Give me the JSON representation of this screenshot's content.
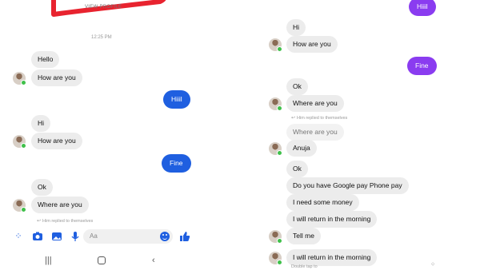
{
  "left": {
    "view_profile": "VIEW PROFILE",
    "timestamp": "12:25 PM",
    "messages": [
      {
        "text": "Hello"
      },
      {
        "text": "How are you"
      },
      {
        "text": "Hiiil"
      },
      {
        "text": "Hi"
      },
      {
        "text": "How are you"
      },
      {
        "text": "Fine"
      },
      {
        "text": "Ok"
      },
      {
        "text": "Where are you"
      }
    ],
    "reply_note": "Him replied to themselves",
    "composer_placeholder": "Aa"
  },
  "right": {
    "messages": [
      {
        "text": "Hiiil"
      },
      {
        "text": "Hi"
      },
      {
        "text": "How are you"
      },
      {
        "text": "Fine"
      },
      {
        "text": "Ok"
      },
      {
        "text": "Where are you"
      },
      {
        "text": "Where are you"
      },
      {
        "text": "Anuja"
      },
      {
        "text": "Ok"
      },
      {
        "text": "Do you have Google pay Phone pay"
      },
      {
        "text": "I need some money"
      },
      {
        "text": "I will return in the morning"
      },
      {
        "text": "Tell me"
      },
      {
        "text": "I will return in the morning"
      }
    ],
    "reply_note": "Him replied to themselves",
    "bottom_note": "Double tap to"
  },
  "colors": {
    "blue_bubble": "#1f5fe0",
    "purple_bubble": "#8a3cf0",
    "incoming_bubble": "#ececec",
    "annotation_red": "#e8232f",
    "online_dot": "#3fc04a"
  },
  "icons": [
    "menu-dots-icon",
    "camera-icon",
    "gallery-icon",
    "mic-icon",
    "emoji-icon",
    "like-icon",
    "recents-icon",
    "home-icon",
    "back-icon",
    "reply-icon"
  ]
}
